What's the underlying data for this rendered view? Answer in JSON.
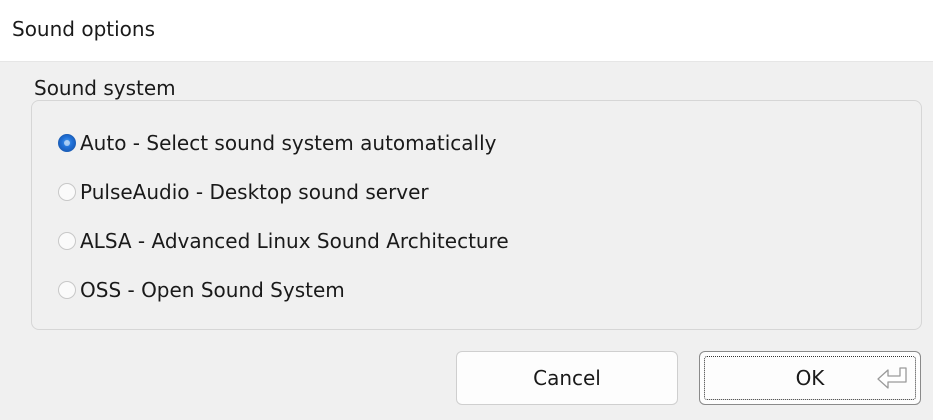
{
  "window": {
    "title": "Sound options"
  },
  "sound_system": {
    "group_label": "Sound system",
    "options": [
      {
        "label": "Auto - Select sound system automatically",
        "selected": true
      },
      {
        "label": "PulseAudio - Desktop sound server",
        "selected": false
      },
      {
        "label": "ALSA - Advanced Linux Sound Architecture",
        "selected": false
      },
      {
        "label": "OSS - Open Sound System",
        "selected": false
      }
    ]
  },
  "buttons": {
    "cancel_label": "Cancel",
    "ok_label": "OK",
    "ok_icon": "enter-key-icon"
  },
  "colors": {
    "dialog_background": "#f0f0f0",
    "title_background": "#ffffff",
    "radio_selected": "#1f6fd6"
  }
}
